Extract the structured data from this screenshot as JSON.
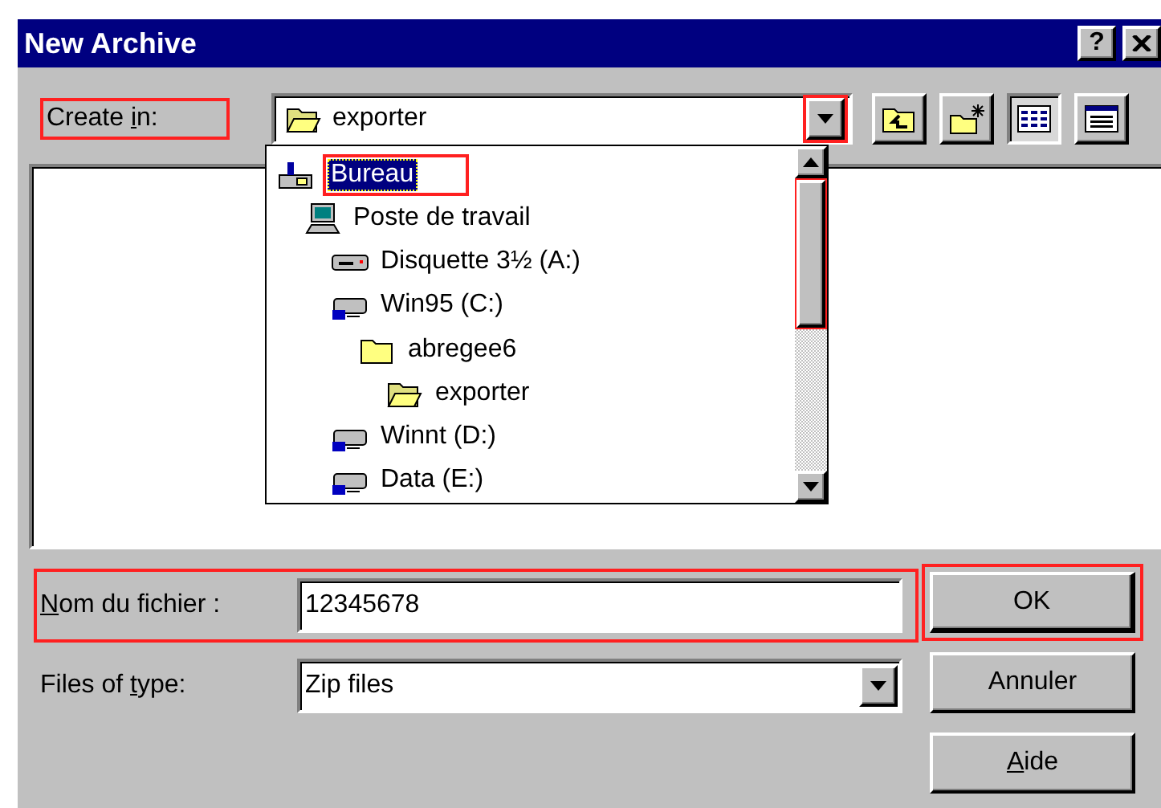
{
  "window": {
    "title": "New Archive",
    "help_button": "?"
  },
  "create_in": {
    "label": {
      "before": "Create ",
      "key": "i",
      "after": "n:"
    },
    "annotated": true,
    "combo": {
      "value": "exporter",
      "kind": "open-folder",
      "dropdown_annotated": true
    }
  },
  "toolbar": [
    {
      "kind": "up-folder",
      "selected": false
    },
    {
      "kind": "new-folder",
      "selected": false
    },
    {
      "kind": "list-view",
      "selected": true
    },
    {
      "kind": "details-view",
      "selected": false
    }
  ],
  "dropdown": {
    "scrollbar_annotated": true,
    "items": [
      {
        "label": "Bureau",
        "kind": "desktop",
        "selected": true,
        "annotated": true,
        "children": [
          {
            "label": "Poste de travail",
            "kind": "computer",
            "selected": false,
            "children": [
              {
                "label": "Disquette 3½ (A:)",
                "kind": "floppy",
                "selected": false
              },
              {
                "label": "Win95 (C:)",
                "kind": "drive",
                "selected": false,
                "children": [
                  {
                    "label": "abregee6",
                    "kind": "folder",
                    "selected": false,
                    "children": [
                      {
                        "label": "exporter",
                        "kind": "open-folder",
                        "selected": false
                      }
                    ]
                  }
                ]
              },
              {
                "label": "Winnt (D:)",
                "kind": "drive",
                "selected": false
              },
              {
                "label": "Data (E:)",
                "kind": "drive",
                "selected": false
              }
            ]
          }
        ]
      }
    ]
  },
  "file_name": {
    "label": {
      "key": "N",
      "after": "om du fichier :"
    },
    "value": "12345678",
    "annotated": true
  },
  "file_type": {
    "label": {
      "before": "Files of ",
      "key": "t",
      "after": "ype:"
    },
    "value": "Zip files"
  },
  "buttons": [
    {
      "label": {
        "after": "OK"
      },
      "default": true,
      "annotated": true
    },
    {
      "label": {
        "after": "Annuler"
      },
      "default": false,
      "annotated": false
    },
    {
      "label": {
        "key": "A",
        "after": "ide"
      },
      "default": false,
      "annotated": false
    }
  ]
}
